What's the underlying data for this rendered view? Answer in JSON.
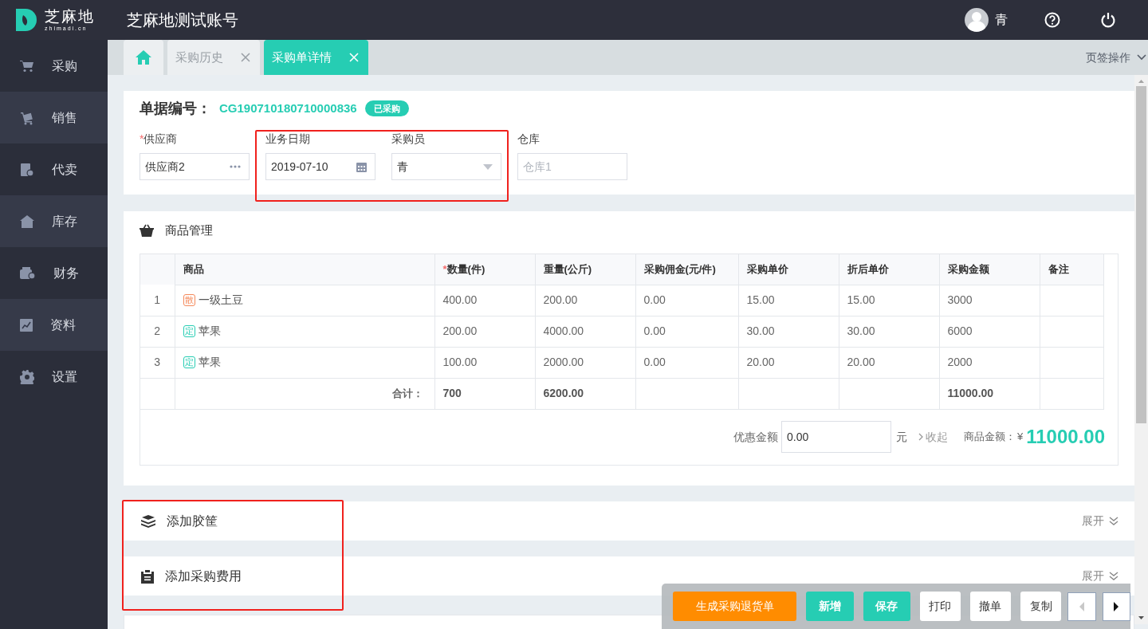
{
  "header": {
    "logo_text": "芝麻地",
    "logo_sub": "zhimadi.cn",
    "account": "芝麻地测试账号",
    "user": "青"
  },
  "sidebar": {
    "items": [
      {
        "label": "采购",
        "kind": "cart"
      },
      {
        "label": "销售",
        "kind": "trolley"
      },
      {
        "label": "代卖",
        "kind": "doc"
      },
      {
        "label": "库存",
        "kind": "house"
      },
      {
        "label": "财务",
        "kind": "wallet"
      },
      {
        "label": "资料",
        "kind": "chart"
      },
      {
        "label": "设置",
        "kind": "gear"
      }
    ]
  },
  "tabs": [
    {
      "kind": "home",
      "selected": false
    },
    {
      "kind": "text",
      "label": "采购历史",
      "selected": false,
      "closable": true
    },
    {
      "kind": "text",
      "label": "采购单详情",
      "selected": true,
      "closable": true
    }
  ],
  "tab_actions": "页签操作",
  "order": {
    "number_label": "单据编号：",
    "number": "CG190710180710000836",
    "status": "已采购",
    "fields": [
      {
        "label": "供应商",
        "required_mark": "*",
        "kind": "picker",
        "value": "供应商2"
      },
      {
        "label": "业务日期",
        "kind": "date",
        "value": "2019-07-10"
      },
      {
        "label": "采购员",
        "kind": "select",
        "value": "青"
      },
      {
        "label": "仓库",
        "kind": "placeholder",
        "placeholder": "仓库1"
      }
    ]
  },
  "goods": {
    "title": "商品管理",
    "columns": [
      {
        "label": "商品"
      },
      {
        "label": "数量(件)",
        "required_mark": "*"
      },
      {
        "label": "重量(公斤)"
      },
      {
        "label": "采购佣金(元/件)"
      },
      {
        "label": "采购单价"
      },
      {
        "label": "折后单价"
      },
      {
        "label": "采购金额"
      },
      {
        "label": "备注"
      }
    ],
    "rows": [
      {
        "index": "1",
        "product": {
          "tag": "散",
          "color": "#f5895a",
          "name": "一级土豆"
        },
        "quantity": "400.00",
        "weight": "200.00",
        "commission": "0.00",
        "unit_price": "15.00",
        "discount_price": "15.00",
        "amount": "3000"
      },
      {
        "index": "2",
        "product": {
          "tag": "定",
          "color": "#26cdb3",
          "name": "苹果"
        },
        "quantity": "200.00",
        "weight": "4000.00",
        "commission": "0.00",
        "unit_price": "30.00",
        "discount_price": "30.00",
        "amount": "6000"
      },
      {
        "index": "3",
        "product": {
          "tag": "定",
          "color": "#26cdb3",
          "name": "苹果"
        },
        "quantity": "100.00",
        "weight": "2000.00",
        "commission": "0.00",
        "unit_price": "20.00",
        "discount_price": "20.00",
        "amount": "2000"
      }
    ],
    "total": {
      "label": "合计：",
      "quantity": "700",
      "weight": "6200.00",
      "amount": "11000.00"
    },
    "discount_label": "优惠金额",
    "discount_value": "0.00",
    "unit": "元",
    "collapse": "收起",
    "amount_label": "商品金额：",
    "currency": "¥",
    "amount": "11000.00"
  },
  "sections": [
    {
      "title": "添加胶筐",
      "kind": "boxes",
      "expand": "展开"
    },
    {
      "title": "添加采购费用",
      "kind": "clipboard",
      "expand": "展开"
    }
  ],
  "actions": [
    {
      "label": "生成采购退货单",
      "kind": "warning"
    },
    {
      "label": "新增",
      "kind": "primary"
    },
    {
      "label": "保存",
      "kind": "primary"
    },
    {
      "label": "打印",
      "kind": "plain"
    },
    {
      "label": "撤单",
      "kind": "plain"
    },
    {
      "label": "复制",
      "kind": "plain"
    },
    {
      "kind": "prev",
      "disabled": true
    },
    {
      "kind": "next",
      "disabled": false
    }
  ]
}
